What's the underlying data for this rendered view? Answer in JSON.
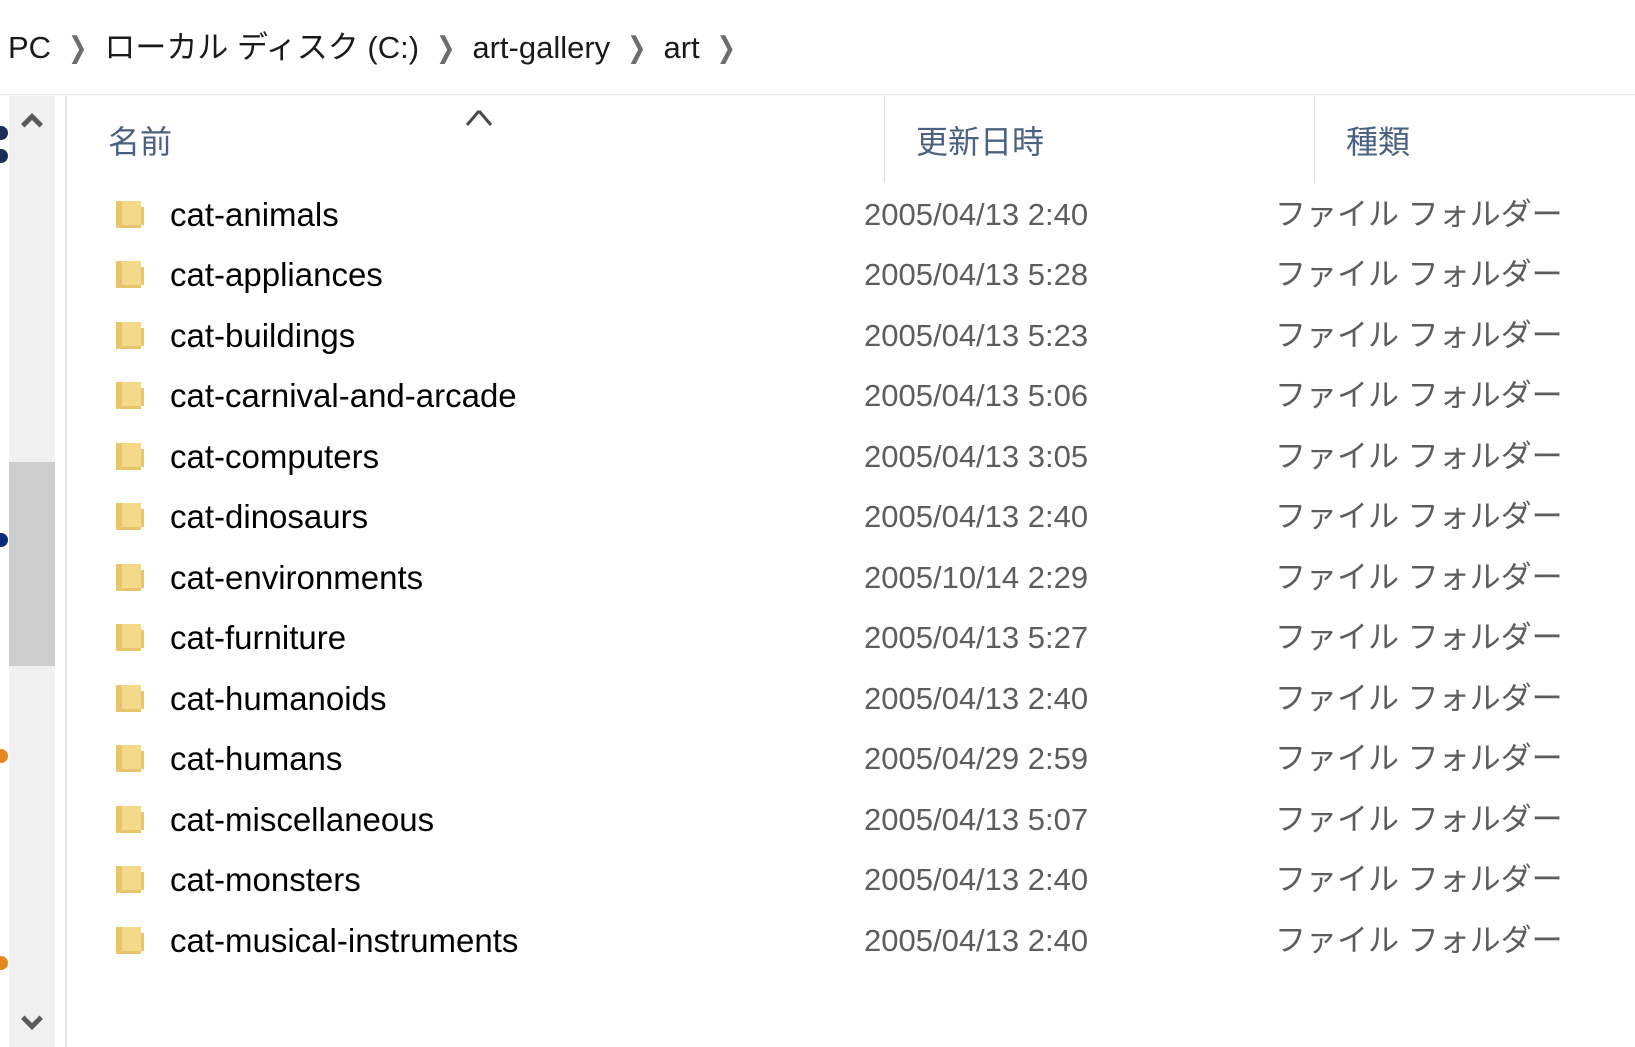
{
  "breadcrumb": {
    "separator": "❯",
    "items": [
      {
        "label": "PC"
      },
      {
        "label": "ローカル ディスク (C:)"
      },
      {
        "label": "art-gallery"
      },
      {
        "label": "art"
      }
    ]
  },
  "columns": {
    "name": "名前",
    "date_modified": "更新日時",
    "type": "種類",
    "sort_indicator": "ascending-caret"
  },
  "scrollbar": {
    "up_arrow": "chevron-up-icon",
    "down_arrow": "chevron-down-icon"
  },
  "rows": [
    {
      "name": "cat-animals",
      "date": "2005/04/13 2:40",
      "type": "ファイル フォルダー"
    },
    {
      "name": "cat-appliances",
      "date": "2005/04/13 5:28",
      "type": "ファイル フォルダー"
    },
    {
      "name": "cat-buildings",
      "date": "2005/04/13 5:23",
      "type": "ファイル フォルダー"
    },
    {
      "name": "cat-carnival-and-arcade",
      "date": "2005/04/13 5:06",
      "type": "ファイル フォルダー"
    },
    {
      "name": "cat-computers",
      "date": "2005/04/13 3:05",
      "type": "ファイル フォルダー"
    },
    {
      "name": "cat-dinosaurs",
      "date": "2005/04/13 2:40",
      "type": "ファイル フォルダー"
    },
    {
      "name": "cat-environments",
      "date": "2005/10/14 2:29",
      "type": "ファイル フォルダー"
    },
    {
      "name": "cat-furniture",
      "date": "2005/04/13 5:27",
      "type": "ファイル フォルダー"
    },
    {
      "name": "cat-humanoids",
      "date": "2005/04/13 2:40",
      "type": "ファイル フォルダー"
    },
    {
      "name": "cat-humans",
      "date": "2005/04/29 2:59",
      "type": "ファイル フォルダー"
    },
    {
      "name": "cat-miscellaneous",
      "date": "2005/04/13 5:07",
      "type": "ファイル フォルダー"
    },
    {
      "name": "cat-monsters",
      "date": "2005/04/13 2:40",
      "type": "ファイル フォルダー"
    },
    {
      "name": "cat-musical-instruments",
      "date": "2005/04/13 2:40",
      "type": "ファイル フォルダー"
    }
  ],
  "colors": {
    "folder_fill": "#f4d98a",
    "folder_tab": "#e8c46a",
    "header_text": "#4a6180",
    "row_text": "#000000",
    "meta_text": "#5d5d5d",
    "scrollbar_track": "#f0f0f0",
    "scrollbar_thumb": "#cdcdcd"
  }
}
